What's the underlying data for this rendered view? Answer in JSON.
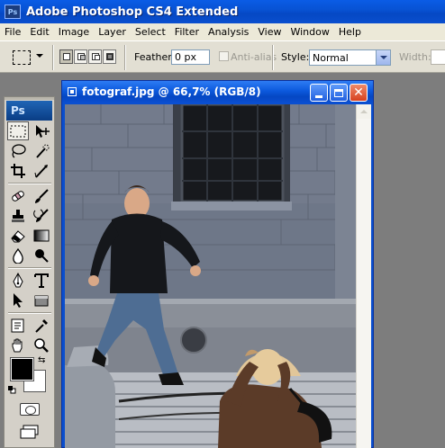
{
  "app": {
    "logo": "Ps",
    "title": "Adobe Photoshop CS4 Extended"
  },
  "menu": [
    "File",
    "Edit",
    "Image",
    "Layer",
    "Select",
    "Filter",
    "Analysis",
    "View",
    "Window",
    "Help"
  ],
  "options": {
    "feather_label": "Feather:",
    "feather_value": "0 px",
    "antialias_label": "Anti-alias",
    "style_label": "Style:",
    "style_value": "Normal",
    "width_label": "Width:"
  },
  "tools_panel": {
    "logo": "Ps"
  },
  "document": {
    "title": "fotograf.jpg @ 66,7% (RGB/8)"
  },
  "colors": {
    "foreground": "#000000",
    "background": "#ffffff",
    "xp_blue": "#0a4fcf",
    "close_red": "#d6411f"
  }
}
